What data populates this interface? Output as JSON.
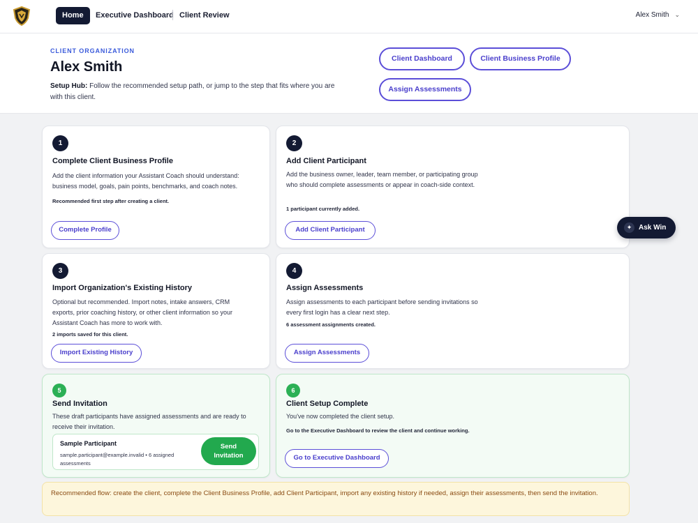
{
  "nav": {
    "home": "Home",
    "links": [
      "Executive Dashboard",
      "Client Review"
    ],
    "user": "Alex Smith",
    "logo_icon": "shield-logo-icon"
  },
  "header": {
    "org_label": "CLIENT ORGANIZATION",
    "client_name": "Alex Smith",
    "hub_label": "Setup Hub:",
    "hub_text": "Follow the recommended setup path, or jump to the step that fits where you are with this client.",
    "buttons": [
      "Client Dashboard",
      "Client Business Profile",
      "Assign Assessments"
    ]
  },
  "steps": [
    {
      "number": "1",
      "title": "Complete Client Business Profile",
      "description": "Add the client information your Assistant Coach should understand: business model, goals, pain points, benchmarks, and coach notes.",
      "note": "Recommended first step after creating a client.",
      "button": "Complete Profile"
    },
    {
      "number": "2",
      "title": "Add Client Participant",
      "description": "Add the business owner, leader, team member, or participating group who should complete assessments or appear in coach-side context.",
      "note": "1 participant currently added.",
      "button": "Add Client Participant"
    },
    {
      "number": "3",
      "title": "Import Organization's Existing History",
      "description": "Optional but recommended. Import notes, intake answers, CRM exports, prior coaching history, or other client information so your Assistant Coach has more to work with.",
      "note": "2 imports saved for this client.",
      "button": "Import Existing History"
    },
    {
      "number": "4",
      "title": "Assign Assessments",
      "description": "Assign assessments to each participant before sending invitations so every first login has a clear next step.",
      "note": "6 assessment assignments created.",
      "button": "Assign Assessments"
    },
    {
      "number": "5",
      "title": "Send Invitation",
      "description": "These draft participants have assigned assessments and are ready to receive their invitation.",
      "participant": {
        "name": "Sample Participant",
        "meta": "sample.participant@example.invalid • 6 assigned assessments",
        "send_button": "Send\nInvitation"
      }
    },
    {
      "number": "6",
      "title": "Client Setup Complete",
      "description": "You've now completed the client setup.",
      "note": "Go to the Executive Dashboard to review the client and continue working.",
      "button": "Go to Executive Dashboard"
    }
  ],
  "ask_win": "Ask Win",
  "recommended_flow": "Recommended flow: create the client, complete the Client Business Profile, add Client Participant, import any existing history if needed, assign their assessments, then send the invitation.",
  "colors": {
    "nav_dark": "#131a33",
    "accent_purple": "#5b4ed8",
    "label_blue": "#3b5bdb",
    "success_green": "#22a94e",
    "flow_bg": "#fdf6dc",
    "flow_text": "#8a4b12"
  }
}
